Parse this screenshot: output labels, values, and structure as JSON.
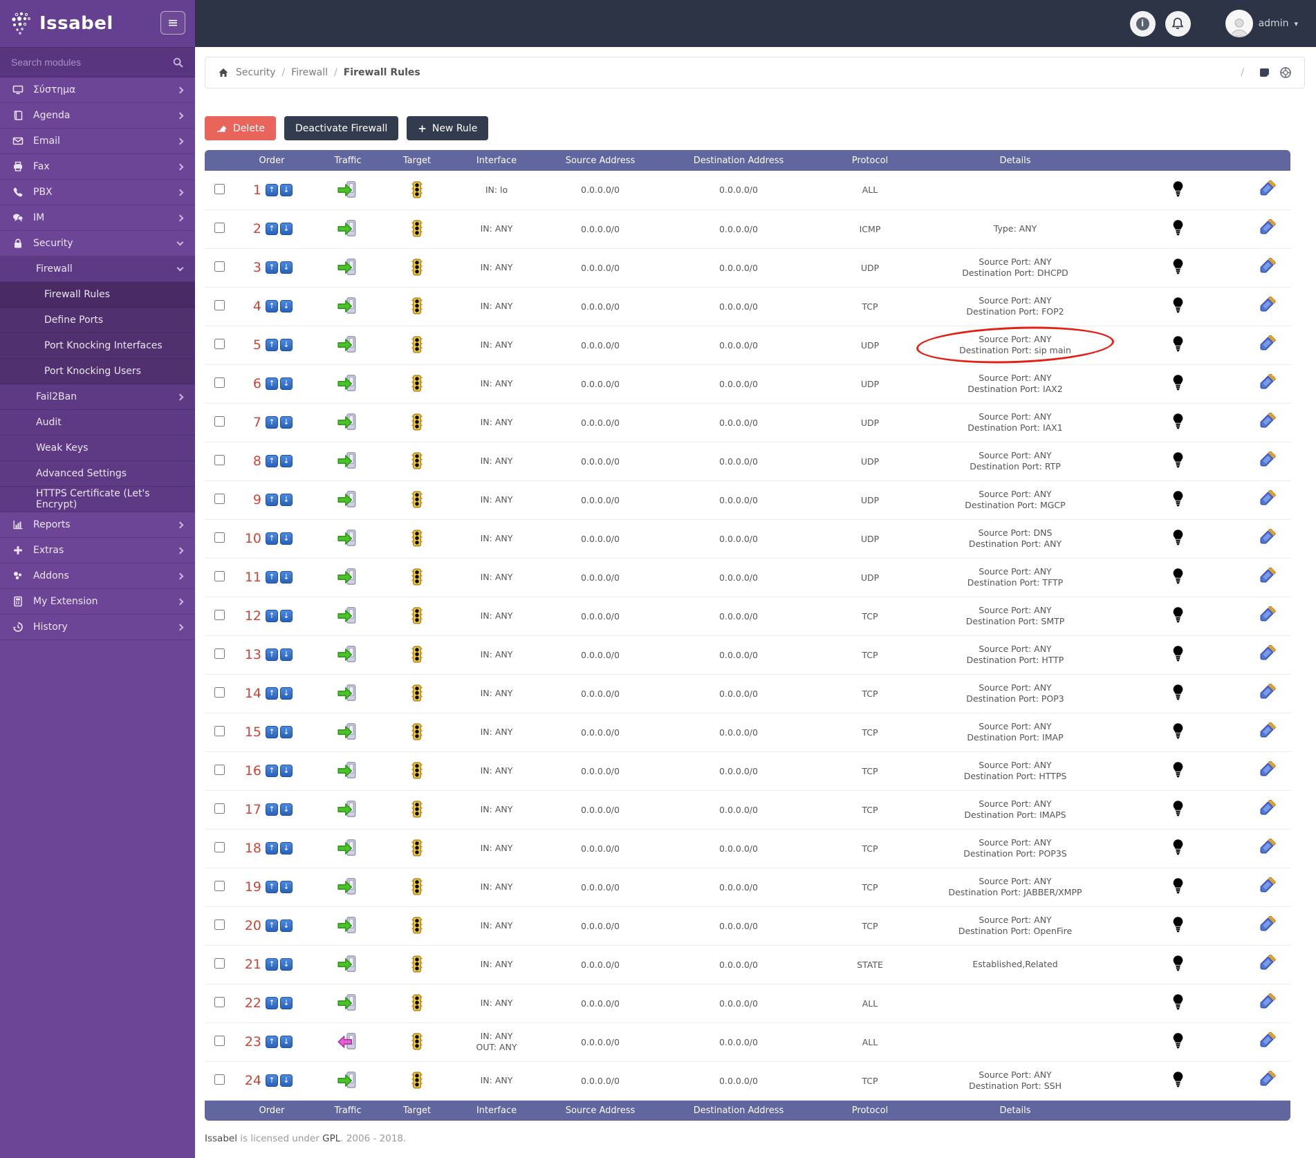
{
  "brand": {
    "logo_text": "Issabel",
    "menu_toggle": "≡"
  },
  "topbar": {
    "user": "admin",
    "info_icon": "i"
  },
  "sidebar": {
    "search_placeholder": "Search modules",
    "items": [
      {
        "label": "Σύστημα",
        "level": 1,
        "icon": "monitor",
        "chevron": "right",
        "active": false
      },
      {
        "label": "Agenda",
        "level": 1,
        "icon": "book",
        "chevron": "right",
        "active": false
      },
      {
        "label": "Email",
        "level": 1,
        "icon": "mail",
        "chevron": "right",
        "active": false
      },
      {
        "label": "Fax",
        "level": 1,
        "icon": "print",
        "chevron": "right",
        "active": false
      },
      {
        "label": "PBX",
        "level": 1,
        "icon": "phone",
        "chevron": "right",
        "active": false
      },
      {
        "label": "IM",
        "level": 1,
        "icon": "chat",
        "chevron": "right",
        "active": false
      },
      {
        "label": "Security",
        "level": 1,
        "icon": "lock",
        "chevron": "down",
        "active": false
      },
      {
        "label": "Firewall",
        "level": 2,
        "icon": null,
        "chevron": "down",
        "active": false
      },
      {
        "label": "Firewall Rules",
        "level": 3,
        "icon": null,
        "chevron": null,
        "active": true
      },
      {
        "label": "Define Ports",
        "level": 3,
        "icon": null,
        "chevron": null,
        "active": false
      },
      {
        "label": "Port Knocking Interfaces",
        "level": 3,
        "icon": null,
        "chevron": null,
        "active": false
      },
      {
        "label": "Port Knocking Users",
        "level": 3,
        "icon": null,
        "chevron": null,
        "active": false
      },
      {
        "label": "Fail2Ban",
        "level": 2,
        "icon": null,
        "chevron": "right",
        "active": false
      },
      {
        "label": "Audit",
        "level": 2,
        "icon": null,
        "chevron": null,
        "active": false
      },
      {
        "label": "Weak Keys",
        "level": 2,
        "icon": null,
        "chevron": null,
        "active": false
      },
      {
        "label": "Advanced Settings",
        "level": 2,
        "icon": null,
        "chevron": null,
        "active": false
      },
      {
        "label": "HTTPS Certificate (Let's Encrypt)",
        "level": 2,
        "icon": null,
        "chevron": null,
        "active": false
      },
      {
        "label": "Reports",
        "level": 1,
        "icon": "chart",
        "chevron": "right",
        "active": false
      },
      {
        "label": "Extras",
        "level": 1,
        "icon": "plus",
        "chevron": "right",
        "active": false
      },
      {
        "label": "Addons",
        "level": 1,
        "icon": "addons",
        "chevron": "right",
        "active": false
      },
      {
        "label": "My Extension",
        "level": 1,
        "icon": "ext",
        "chevron": "right",
        "active": false
      },
      {
        "label": "History",
        "level": 1,
        "icon": "history",
        "chevron": "right",
        "active": false
      }
    ]
  },
  "breadcrumb": {
    "separator": "/",
    "items": [
      "Security",
      "Firewall",
      "Firewall Rules"
    ]
  },
  "toolbar": {
    "delete_label": "Delete",
    "deactivate_label": "Deactivate Firewall",
    "new_rule_label": "New Rule",
    "plus": "+"
  },
  "table": {
    "columns": [
      "Order",
      "Traffic",
      "Target",
      "Interface",
      "Source Address",
      "Destination Address",
      "Protocol",
      "Details"
    ],
    "up_arrow": "↑",
    "down_arrow": "↓",
    "rows": [
      {
        "order": 1,
        "traffic": "in",
        "target": "accept",
        "iface": [
          "IN: lo"
        ],
        "src": "0.0.0.0/0",
        "dst": "0.0.0.0/0",
        "proto": "ALL",
        "details": [],
        "bulb": "on",
        "annotated": false
      },
      {
        "order": 2,
        "traffic": "in",
        "target": "accept",
        "iface": [
          "IN: ANY"
        ],
        "src": "0.0.0.0/0",
        "dst": "0.0.0.0/0",
        "proto": "ICMP",
        "details": [
          "Type: ANY"
        ],
        "bulb": "on",
        "annotated": false
      },
      {
        "order": 3,
        "traffic": "in",
        "target": "accept",
        "iface": [
          "IN: ANY"
        ],
        "src": "0.0.0.0/0",
        "dst": "0.0.0.0/0",
        "proto": "UDP",
        "details": [
          "Source Port: ANY",
          "Destination Port: DHCPD"
        ],
        "bulb": "off",
        "annotated": false
      },
      {
        "order": 4,
        "traffic": "in",
        "target": "accept",
        "iface": [
          "IN: ANY"
        ],
        "src": "0.0.0.0/0",
        "dst": "0.0.0.0/0",
        "proto": "TCP",
        "details": [
          "Source Port: ANY",
          "Destination Port: FOP2"
        ],
        "bulb": "off",
        "annotated": false
      },
      {
        "order": 5,
        "traffic": "in",
        "target": "accept",
        "iface": [
          "IN: ANY"
        ],
        "src": "0.0.0.0/0",
        "dst": "0.0.0.0/0",
        "proto": "UDP",
        "details": [
          "Source Port: ANY",
          "Destination Port: sip main"
        ],
        "bulb": "on",
        "annotated": true
      },
      {
        "order": 6,
        "traffic": "in",
        "target": "accept",
        "iface": [
          "IN: ANY"
        ],
        "src": "0.0.0.0/0",
        "dst": "0.0.0.0/0",
        "proto": "UDP",
        "details": [
          "Source Port: ANY",
          "Destination Port: IAX2"
        ],
        "bulb": "off",
        "annotated": false
      },
      {
        "order": 7,
        "traffic": "in",
        "target": "accept",
        "iface": [
          "IN: ANY"
        ],
        "src": "0.0.0.0/0",
        "dst": "0.0.0.0/0",
        "proto": "UDP",
        "details": [
          "Source Port: ANY",
          "Destination Port: IAX1"
        ],
        "bulb": "off",
        "annotated": false
      },
      {
        "order": 8,
        "traffic": "in",
        "target": "accept",
        "iface": [
          "IN: ANY"
        ],
        "src": "0.0.0.0/0",
        "dst": "0.0.0.0/0",
        "proto": "UDP",
        "details": [
          "Source Port: ANY",
          "Destination Port: RTP"
        ],
        "bulb": "off",
        "annotated": false
      },
      {
        "order": 9,
        "traffic": "in",
        "target": "accept",
        "iface": [
          "IN: ANY"
        ],
        "src": "0.0.0.0/0",
        "dst": "0.0.0.0/0",
        "proto": "UDP",
        "details": [
          "Source Port: ANY",
          "Destination Port: MGCP"
        ],
        "bulb": "off",
        "annotated": false
      },
      {
        "order": 10,
        "traffic": "in",
        "target": "accept",
        "iface": [
          "IN: ANY"
        ],
        "src": "0.0.0.0/0",
        "dst": "0.0.0.0/0",
        "proto": "UDP",
        "details": [
          "Source Port: DNS",
          "Destination Port: ANY"
        ],
        "bulb": "off",
        "annotated": false
      },
      {
        "order": 11,
        "traffic": "in",
        "target": "accept",
        "iface": [
          "IN: ANY"
        ],
        "src": "0.0.0.0/0",
        "dst": "0.0.0.0/0",
        "proto": "UDP",
        "details": [
          "Source Port: ANY",
          "Destination Port: TFTP"
        ],
        "bulb": "off",
        "annotated": false
      },
      {
        "order": 12,
        "traffic": "in",
        "target": "accept",
        "iface": [
          "IN: ANY"
        ],
        "src": "0.0.0.0/0",
        "dst": "0.0.0.0/0",
        "proto": "TCP",
        "details": [
          "Source Port: ANY",
          "Destination Port: SMTP"
        ],
        "bulb": "on",
        "annotated": false
      },
      {
        "order": 13,
        "traffic": "in",
        "target": "accept",
        "iface": [
          "IN: ANY"
        ],
        "src": "0.0.0.0/0",
        "dst": "0.0.0.0/0",
        "proto": "TCP",
        "details": [
          "Source Port: ANY",
          "Destination Port: HTTP"
        ],
        "bulb": "on",
        "annotated": false
      },
      {
        "order": 14,
        "traffic": "in",
        "target": "accept",
        "iface": [
          "IN: ANY"
        ],
        "src": "0.0.0.0/0",
        "dst": "0.0.0.0/0",
        "proto": "TCP",
        "details": [
          "Source Port: ANY",
          "Destination Port: POP3"
        ],
        "bulb": "off",
        "annotated": false
      },
      {
        "order": 15,
        "traffic": "in",
        "target": "accept",
        "iface": [
          "IN: ANY"
        ],
        "src": "0.0.0.0/0",
        "dst": "0.0.0.0/0",
        "proto": "TCP",
        "details": [
          "Source Port: ANY",
          "Destination Port: IMAP"
        ],
        "bulb": "off",
        "annotated": false
      },
      {
        "order": 16,
        "traffic": "in",
        "target": "accept",
        "iface": [
          "IN: ANY"
        ],
        "src": "0.0.0.0/0",
        "dst": "0.0.0.0/0",
        "proto": "TCP",
        "details": [
          "Source Port: ANY",
          "Destination Port: HTTPS"
        ],
        "bulb": "on",
        "annotated": false
      },
      {
        "order": 17,
        "traffic": "in",
        "target": "accept",
        "iface": [
          "IN: ANY"
        ],
        "src": "0.0.0.0/0",
        "dst": "0.0.0.0/0",
        "proto": "TCP",
        "details": [
          "Source Port: ANY",
          "Destination Port: IMAPS"
        ],
        "bulb": "off",
        "annotated": false
      },
      {
        "order": 18,
        "traffic": "in",
        "target": "accept",
        "iface": [
          "IN: ANY"
        ],
        "src": "0.0.0.0/0",
        "dst": "0.0.0.0/0",
        "proto": "TCP",
        "details": [
          "Source Port: ANY",
          "Destination Port: POP3S"
        ],
        "bulb": "off",
        "annotated": false
      },
      {
        "order": 19,
        "traffic": "in",
        "target": "accept",
        "iface": [
          "IN: ANY"
        ],
        "src": "0.0.0.0/0",
        "dst": "0.0.0.0/0",
        "proto": "TCP",
        "details": [
          "Source Port: ANY",
          "Destination Port: JABBER/XMPP"
        ],
        "bulb": "off",
        "annotated": false
      },
      {
        "order": 20,
        "traffic": "in",
        "target": "accept",
        "iface": [
          "IN: ANY"
        ],
        "src": "0.0.0.0/0",
        "dst": "0.0.0.0/0",
        "proto": "TCP",
        "details": [
          "Source Port: ANY",
          "Destination Port: OpenFire"
        ],
        "bulb": "off",
        "annotated": false
      },
      {
        "order": 21,
        "traffic": "in",
        "target": "accept",
        "iface": [
          "IN: ANY"
        ],
        "src": "0.0.0.0/0",
        "dst": "0.0.0.0/0",
        "proto": "STATE",
        "details": [
          "Established,Related"
        ],
        "bulb": "on",
        "annotated": false
      },
      {
        "order": 22,
        "traffic": "in",
        "target": "reject",
        "iface": [
          "IN: ANY"
        ],
        "src": "0.0.0.0/0",
        "dst": "0.0.0.0/0",
        "proto": "ALL",
        "details": [],
        "bulb": "on",
        "annotated": false
      },
      {
        "order": 23,
        "traffic": "out",
        "target": "reject",
        "iface": [
          "IN: ANY",
          "OUT: ANY"
        ],
        "src": "0.0.0.0/0",
        "dst": "0.0.0.0/0",
        "proto": "ALL",
        "details": [],
        "bulb": "on",
        "annotated": false
      },
      {
        "order": 24,
        "traffic": "in",
        "target": "accept",
        "iface": [
          "IN: ANY"
        ],
        "src": "0.0.0.0/0",
        "dst": "0.0.0.0/0",
        "proto": "TCP",
        "details": [
          "Source Port: ANY",
          "Destination Port: SSH"
        ],
        "bulb": "off",
        "annotated": false
      }
    ]
  },
  "footer": {
    "brand": "Issabel",
    "text1": " is licensed under ",
    "gpl": "GPL",
    "text2": ". 2006 - 2018."
  }
}
